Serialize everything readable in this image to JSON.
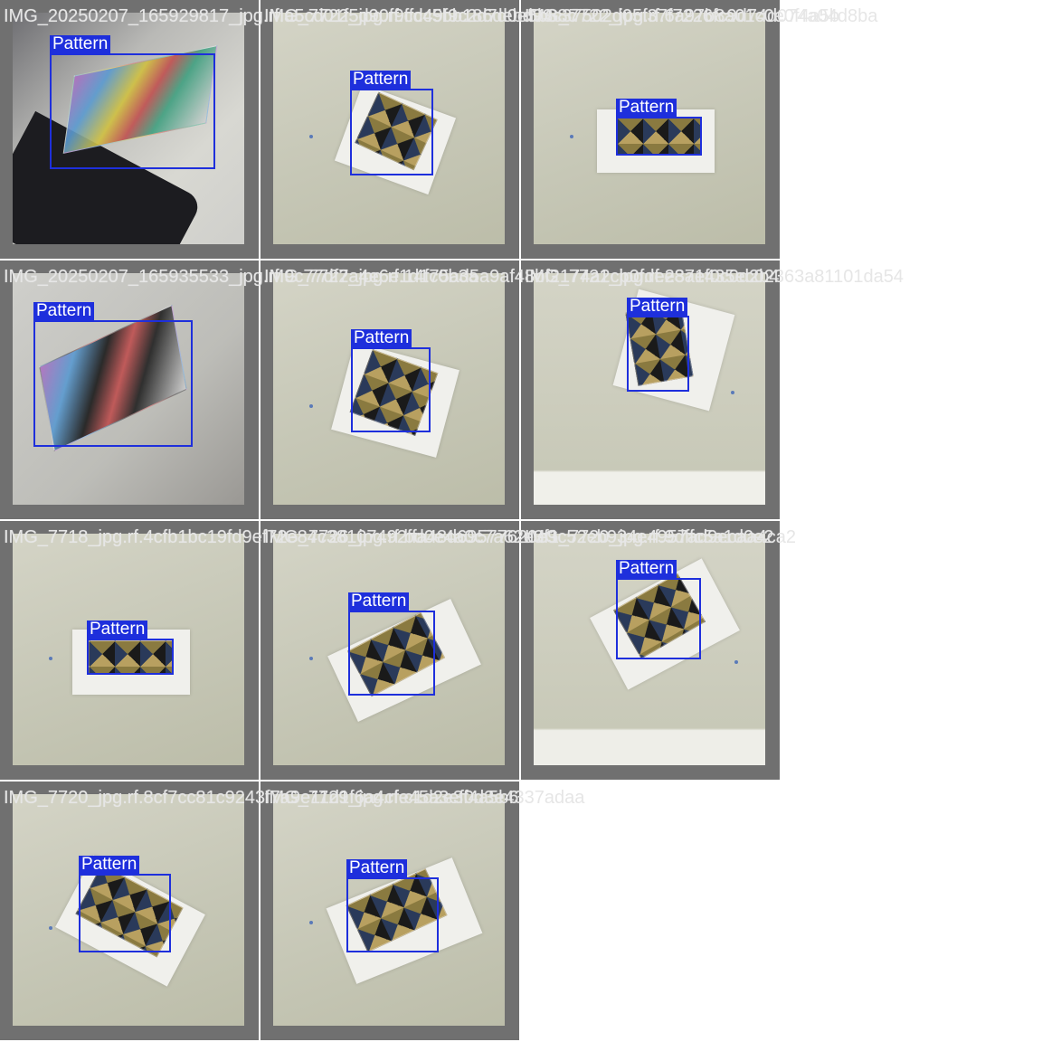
{
  "label": "Pattern",
  "tiles": [
    {
      "filename": "IMG_20250207_165929817_jpg.rf.a5cd01f5d90f9ffc49f9c2d7d0e5b88c"
    },
    {
      "filename": "IMG_7722_jpg.rf.cdc5bb186debd93c37502d05f37f7226fc9d74d074a04d8ba"
    },
    {
      "filename": "IMG_7722_jpg.rf.6a97b8a01c0e0f4a5b"
    },
    {
      "filename": "IMG_20250207_165935533_jpg.rf.9c77df2a4e6e1d1c0b3a"
    },
    {
      "filename": "IMG_7727_jpg.rf.14f75ad5a9af48bf2174a2cb0fde237e435ec02363a81101da54"
    },
    {
      "filename": "IMG_7721_jpg.rf.e8a1f0c0d2b4"
    },
    {
      "filename": "IMG_7718_jpg.rf.4cfb1bc19fd9ef72e84c38107492ffa48d69577620e9c52eb934e4957ad9ecaa4ca2"
    },
    {
      "filename": "IMG_7726_jpg.rf.bd0e4a0c7a62e3f1"
    },
    {
      "filename": "IMG_7720_jpg.rf.9dffc5a1d0e2"
    },
    {
      "filename": "IMG_7720_jpg.rf.8cf7cc81c9243f7a9e11d1f6a4cfe45a3ef0d3e4337adaa"
    },
    {
      "filename": "IMG_7729_jpg.rf.c1d2e3f4a5b6"
    }
  ]
}
